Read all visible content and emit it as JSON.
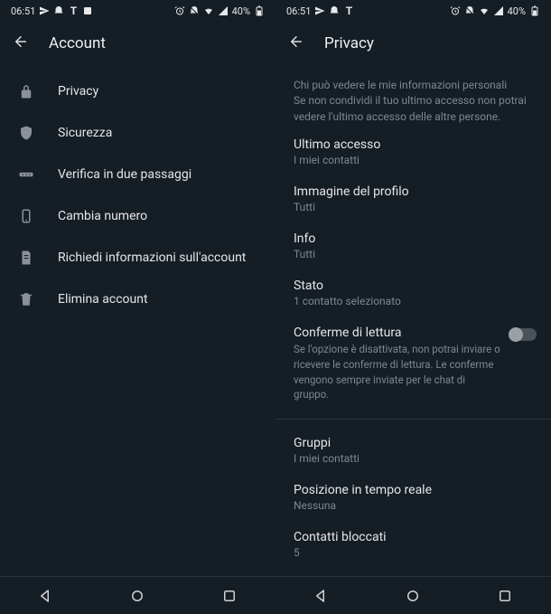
{
  "status": {
    "time": "06:51",
    "battery": "40%"
  },
  "left": {
    "title": "Account",
    "items": [
      {
        "label": "Privacy"
      },
      {
        "label": "Sicurezza"
      },
      {
        "label": "Verifica in due passaggi"
      },
      {
        "label": "Cambia numero"
      },
      {
        "label": "Richiedi informazioni sull'account"
      },
      {
        "label": "Elimina account"
      }
    ]
  },
  "right": {
    "title": "Privacy",
    "desc_heading": "Chi può vedere le mie informazioni personali",
    "desc_sub": "Se non condividi il tuo ultimo accesso non potrai vedere l'ultimo accesso delle altre persone.",
    "settings": {
      "last_seen": {
        "label": "Ultimo accesso",
        "value": "I miei contatti"
      },
      "profile_photo": {
        "label": "Immagine del profilo",
        "value": "Tutti"
      },
      "info": {
        "label": "Info",
        "value": "Tutti"
      },
      "status": {
        "label": "Stato",
        "value": "1 contatto selezionato"
      },
      "read_receipts": {
        "label": "Conferme di lettura",
        "desc": "Se l'opzione è disattivata, non potrai inviare o ricevere le conferme di lettura. Le conferme vengono sempre inviate per le chat di gruppo."
      },
      "groups": {
        "label": "Gruppi",
        "value": "I miei contatti"
      },
      "live_location": {
        "label": "Posizione in tempo reale",
        "value": "Nessuna"
      },
      "blocked": {
        "label": "Contatti bloccati",
        "value": "5"
      }
    }
  }
}
